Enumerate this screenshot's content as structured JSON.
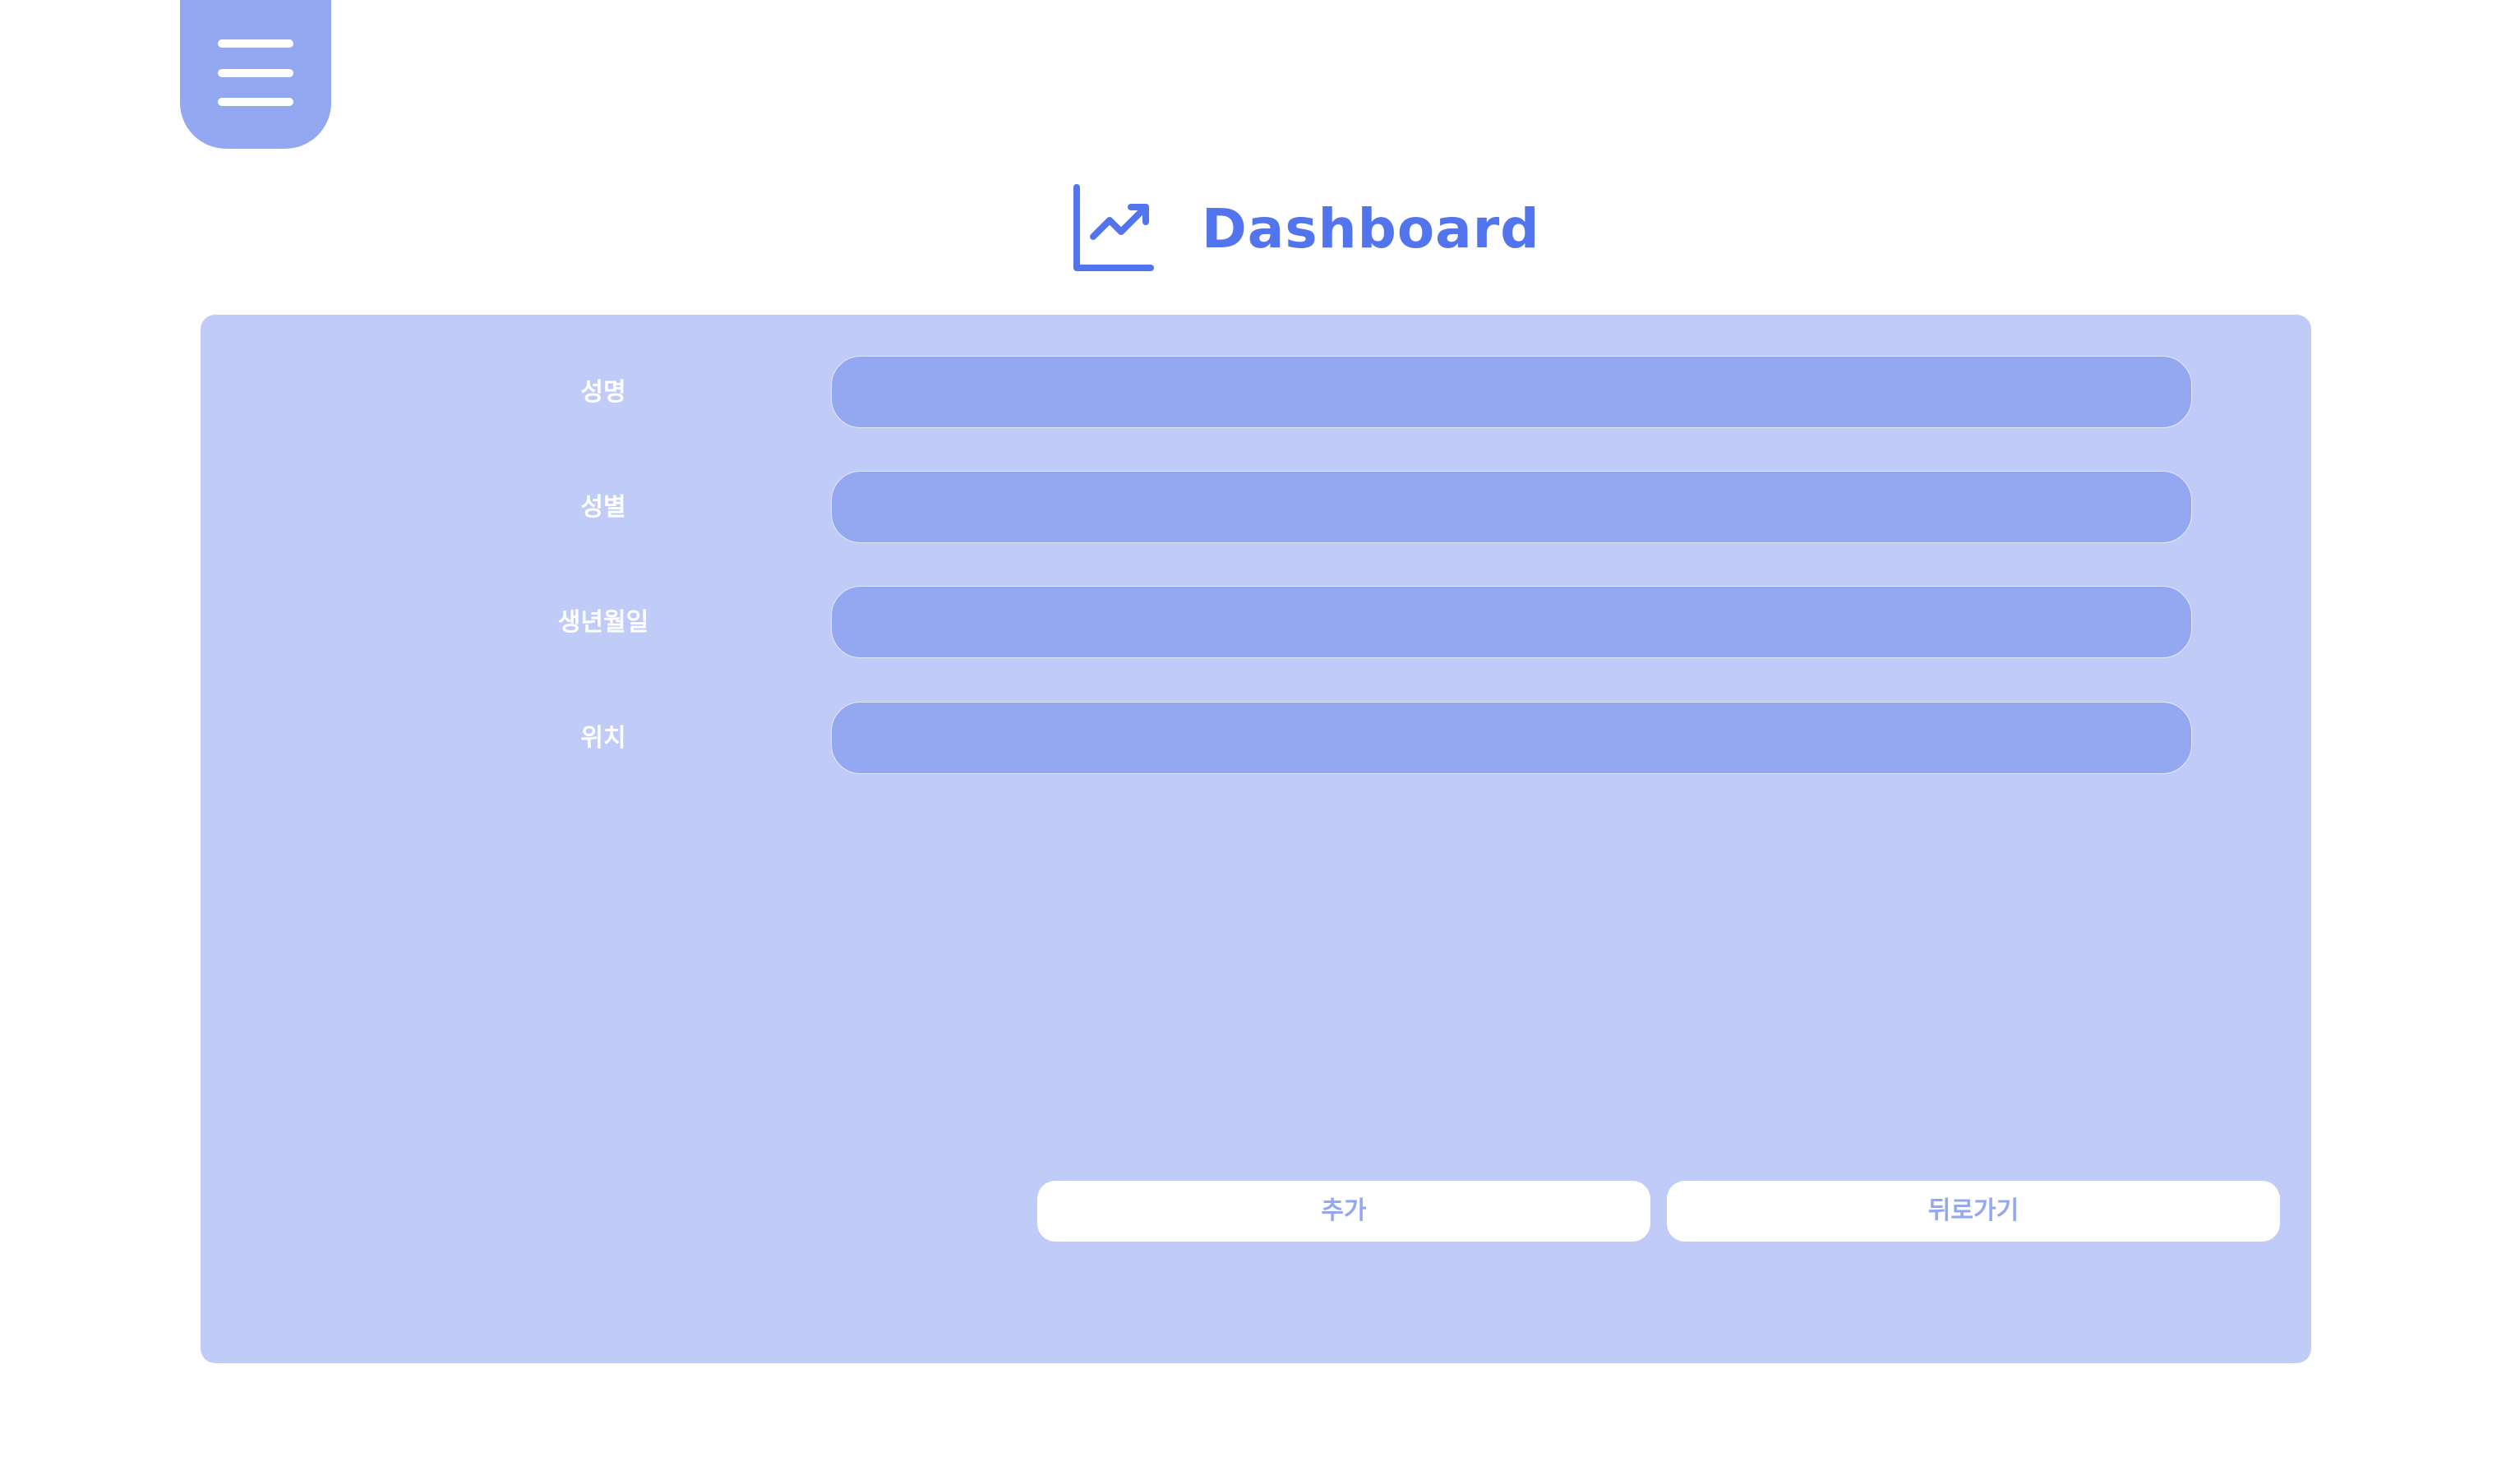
{
  "menu": {
    "icon": "hamburger-menu-icon"
  },
  "header": {
    "icon": "trending-chart-icon",
    "title": "Dashboard",
    "accent_color": "#5274ec"
  },
  "form": {
    "fields": [
      {
        "label": "성명",
        "value": ""
      },
      {
        "label": "성별",
        "value": ""
      },
      {
        "label": "생년월일",
        "value": ""
      },
      {
        "label": "위치",
        "value": ""
      }
    ]
  },
  "buttons": {
    "add_label": "추가",
    "back_label": "뒤로가기"
  },
  "colors": {
    "panel": "#c0cbf7",
    "field": "#94a8f2",
    "menu": "#94a8f2",
    "accent": "#5274ec",
    "button_text": "#94a8f2"
  }
}
